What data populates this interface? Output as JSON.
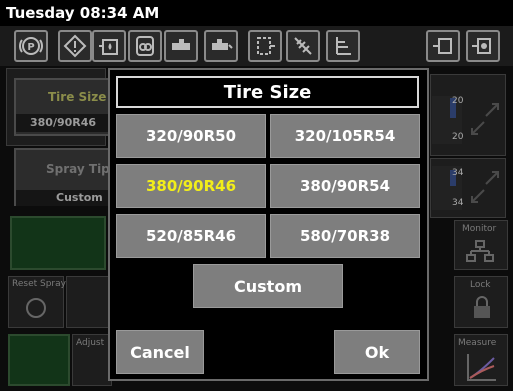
{
  "status_bar": {
    "datetime": "Tuesday 08:34 AM"
  },
  "toolbar_icons": [
    "parking-brake-icon",
    "warning-icon",
    "hydraulic-fluid-icon",
    "transmission-icon",
    "engine-rpm-icon",
    "engine-oil-icon",
    "coolant-icon",
    "no-spray-icon",
    "fuel-level-icon",
    "hydraulic-oil-temp-icon",
    "oil-pressure-icon"
  ],
  "background": {
    "tire_size_tile": {
      "label": "Tire Size",
      "value": "380/90R46"
    },
    "spray_tip_tile": {
      "label": "Spray Tip",
      "value": "Custom"
    },
    "gauge_top": {
      "a": "20",
      "b": "20"
    },
    "gauge_mid": {
      "a": "34",
      "b": "34"
    },
    "monitor_label": "Monitor",
    "lock_label": "Lock",
    "reset_spray_label": "Reset Spray",
    "adjust_label": "Adjust",
    "measure_label": "Measure"
  },
  "dialog": {
    "title": "Tire Size",
    "options": [
      "320/90R50",
      "320/105R54",
      "380/90R46",
      "380/90R54",
      "520/85R46",
      "580/70R38"
    ],
    "selected": "380/90R46",
    "custom_label": "Custom",
    "cancel_label": "Cancel",
    "ok_label": "Ok"
  },
  "colors": {
    "selected_text": "#f2ee1a",
    "button_gray": "#7e7e7e",
    "background": "#0c0c0c"
  }
}
